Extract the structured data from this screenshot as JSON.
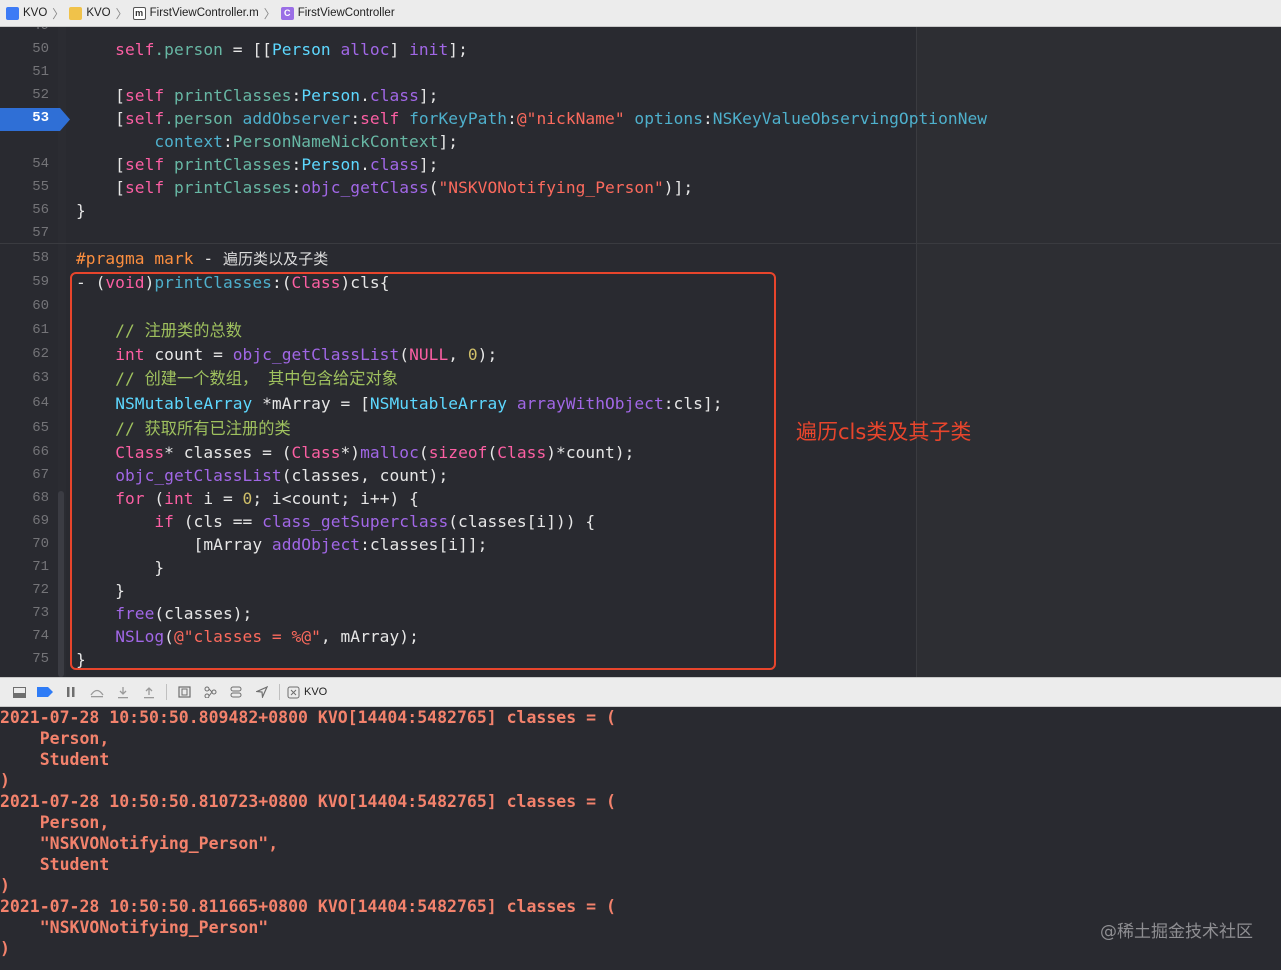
{
  "jumpbar": {
    "items": [
      {
        "label": "KVO",
        "icon": "project-icon"
      },
      {
        "label": "KVO",
        "icon": "folder-icon"
      },
      {
        "label": "FirstViewController.m",
        "icon": "objc-file-icon"
      },
      {
        "label": "FirstViewController",
        "icon": "class-icon"
      }
    ]
  },
  "editor": {
    "line_numbers": [
      "50",
      "51",
      "52",
      "53",
      "",
      "54",
      "55",
      "56",
      "57",
      "58",
      "59",
      "60",
      "61",
      "62",
      "63",
      "64",
      "65",
      "66",
      "67",
      "68",
      "69",
      "70",
      "71",
      "72",
      "73",
      "74",
      "75"
    ],
    "active_line": "53",
    "code": {
      "l50a": "    self",
      "l50b": ".person",
      "l50c": " = [[",
      "l50d": "Person",
      "l50e": " ",
      "l50f": "alloc",
      "l50g": "] ",
      "l50h": "init",
      "l50i": "];",
      "l52a": "    [",
      "l52b": "self",
      "l52c": " ",
      "l52d": "printClasses",
      "l52e": ":",
      "l52f": "Person",
      "l52g": ".",
      "l52h": "class",
      "l52i": "];",
      "l53a": "    [",
      "l53b": "self",
      "l53c": ".person",
      "l53d": " ",
      "l53e": "addObserver",
      "l53f": ":",
      "l53g": "self",
      "l53h": " ",
      "l53i": "forKeyPath",
      "l53j": ":",
      "l53k": "@\"nickName\"",
      "l53l": " ",
      "l53m": "options",
      "l53n": ":",
      "l53o": "NSKeyValueObservingOptionNew",
      "l53w1": "        context",
      "l53w2": ":",
      "l53w3": "PersonNameNickContext",
      "l53w4": "];",
      "l54a": "    [",
      "l54b": "self",
      "l54c": " ",
      "l54d": "printClasses",
      "l54e": ":",
      "l54f": "Person",
      "l54g": ".",
      "l54h": "class",
      "l54i": "];",
      "l55a": "    [",
      "l55b": "self",
      "l55c": " ",
      "l55d": "printClasses",
      "l55e": ":",
      "l55f": "objc_getClass",
      "l55g": "(",
      "l55h": "\"NSKVONotifying_Person\"",
      "l55i": ")];",
      "l56": "}",
      "l58a": "#pragma mark",
      "l58b": " - ",
      "l58c": "遍历类以及子类",
      "l59a": "- (",
      "l59b": "void",
      "l59c": ")",
      "l59d": "printClasses",
      "l59e": ":(",
      "l59f": "Class",
      "l59g": ")cls{",
      "l61": "    // 注册类的总数",
      "l62a": "    ",
      "l62b": "int",
      "l62c": " count = ",
      "l62d": "objc_getClassList",
      "l62e": "(",
      "l62f": "NULL",
      "l62g": ", ",
      "l62h": "0",
      "l62i": ");",
      "l63": "    // 创建一个数组， 其中包含给定对象",
      "l64a": "    ",
      "l64b": "NSMutableArray",
      "l64c": " *mArray = [",
      "l64d": "NSMutableArray",
      "l64e": " ",
      "l64f": "arrayWithObject",
      "l64g": ":cls];",
      "l65": "    // 获取所有已注册的类",
      "l66a": "    ",
      "l66b": "Class",
      "l66c": "* classes = (",
      "l66d": "Class",
      "l66e": "*)",
      "l66f": "malloc",
      "l66g": "(",
      "l66h": "sizeof",
      "l66i": "(",
      "l66j": "Class",
      "l66k": ")*count);",
      "l67a": "    ",
      "l67b": "objc_getClassList",
      "l67c": "(classes, count);",
      "l68a": "    ",
      "l68b": "for",
      "l68c": " (",
      "l68d": "int",
      "l68e": " i = ",
      "l68f": "0",
      "l68g": "; i<count; i++) {",
      "l69a": "        ",
      "l69b": "if",
      "l69c": " (cls == ",
      "l69d": "class_getSuperclass",
      "l69e": "(classes[i])) {",
      "l70a": "            [mArray ",
      "l70b": "addObject",
      "l70c": ":classes[i]];",
      "l71": "        }",
      "l72": "    }",
      "l73a": "    ",
      "l73b": "free",
      "l73c": "(classes);",
      "l74a": "    ",
      "l74b": "NSLog",
      "l74c": "(",
      "l74d": "@\"classes = %@\"",
      "l74e": ", mArray);",
      "l75": "}"
    },
    "annotation": "遍历cls类及其子类"
  },
  "debugbar": {
    "target_label": "KVO"
  },
  "console": {
    "lines": [
      "2021-07-28 10:50:50.809482+0800 KVO[14404:5482765] classes = (",
      "    Person,",
      "    Student",
      ")",
      "2021-07-28 10:50:50.810723+0800 KVO[14404:5482765] classes = (",
      "    Person,",
      "    \"NSKVONotifying_Person\",",
      "    Student",
      ")",
      "2021-07-28 10:50:50.811665+0800 KVO[14404:5482765] classes = (",
      "    \"NSKVONotifying_Person\"",
      ")"
    ]
  },
  "watermark": "@稀土掘金技术社区",
  "colors": {
    "editor_bg": "#292a30",
    "console_text": "#f3826c",
    "annotation_red": "#e8452c",
    "breakpoint_blue": "#2f6fd6"
  }
}
